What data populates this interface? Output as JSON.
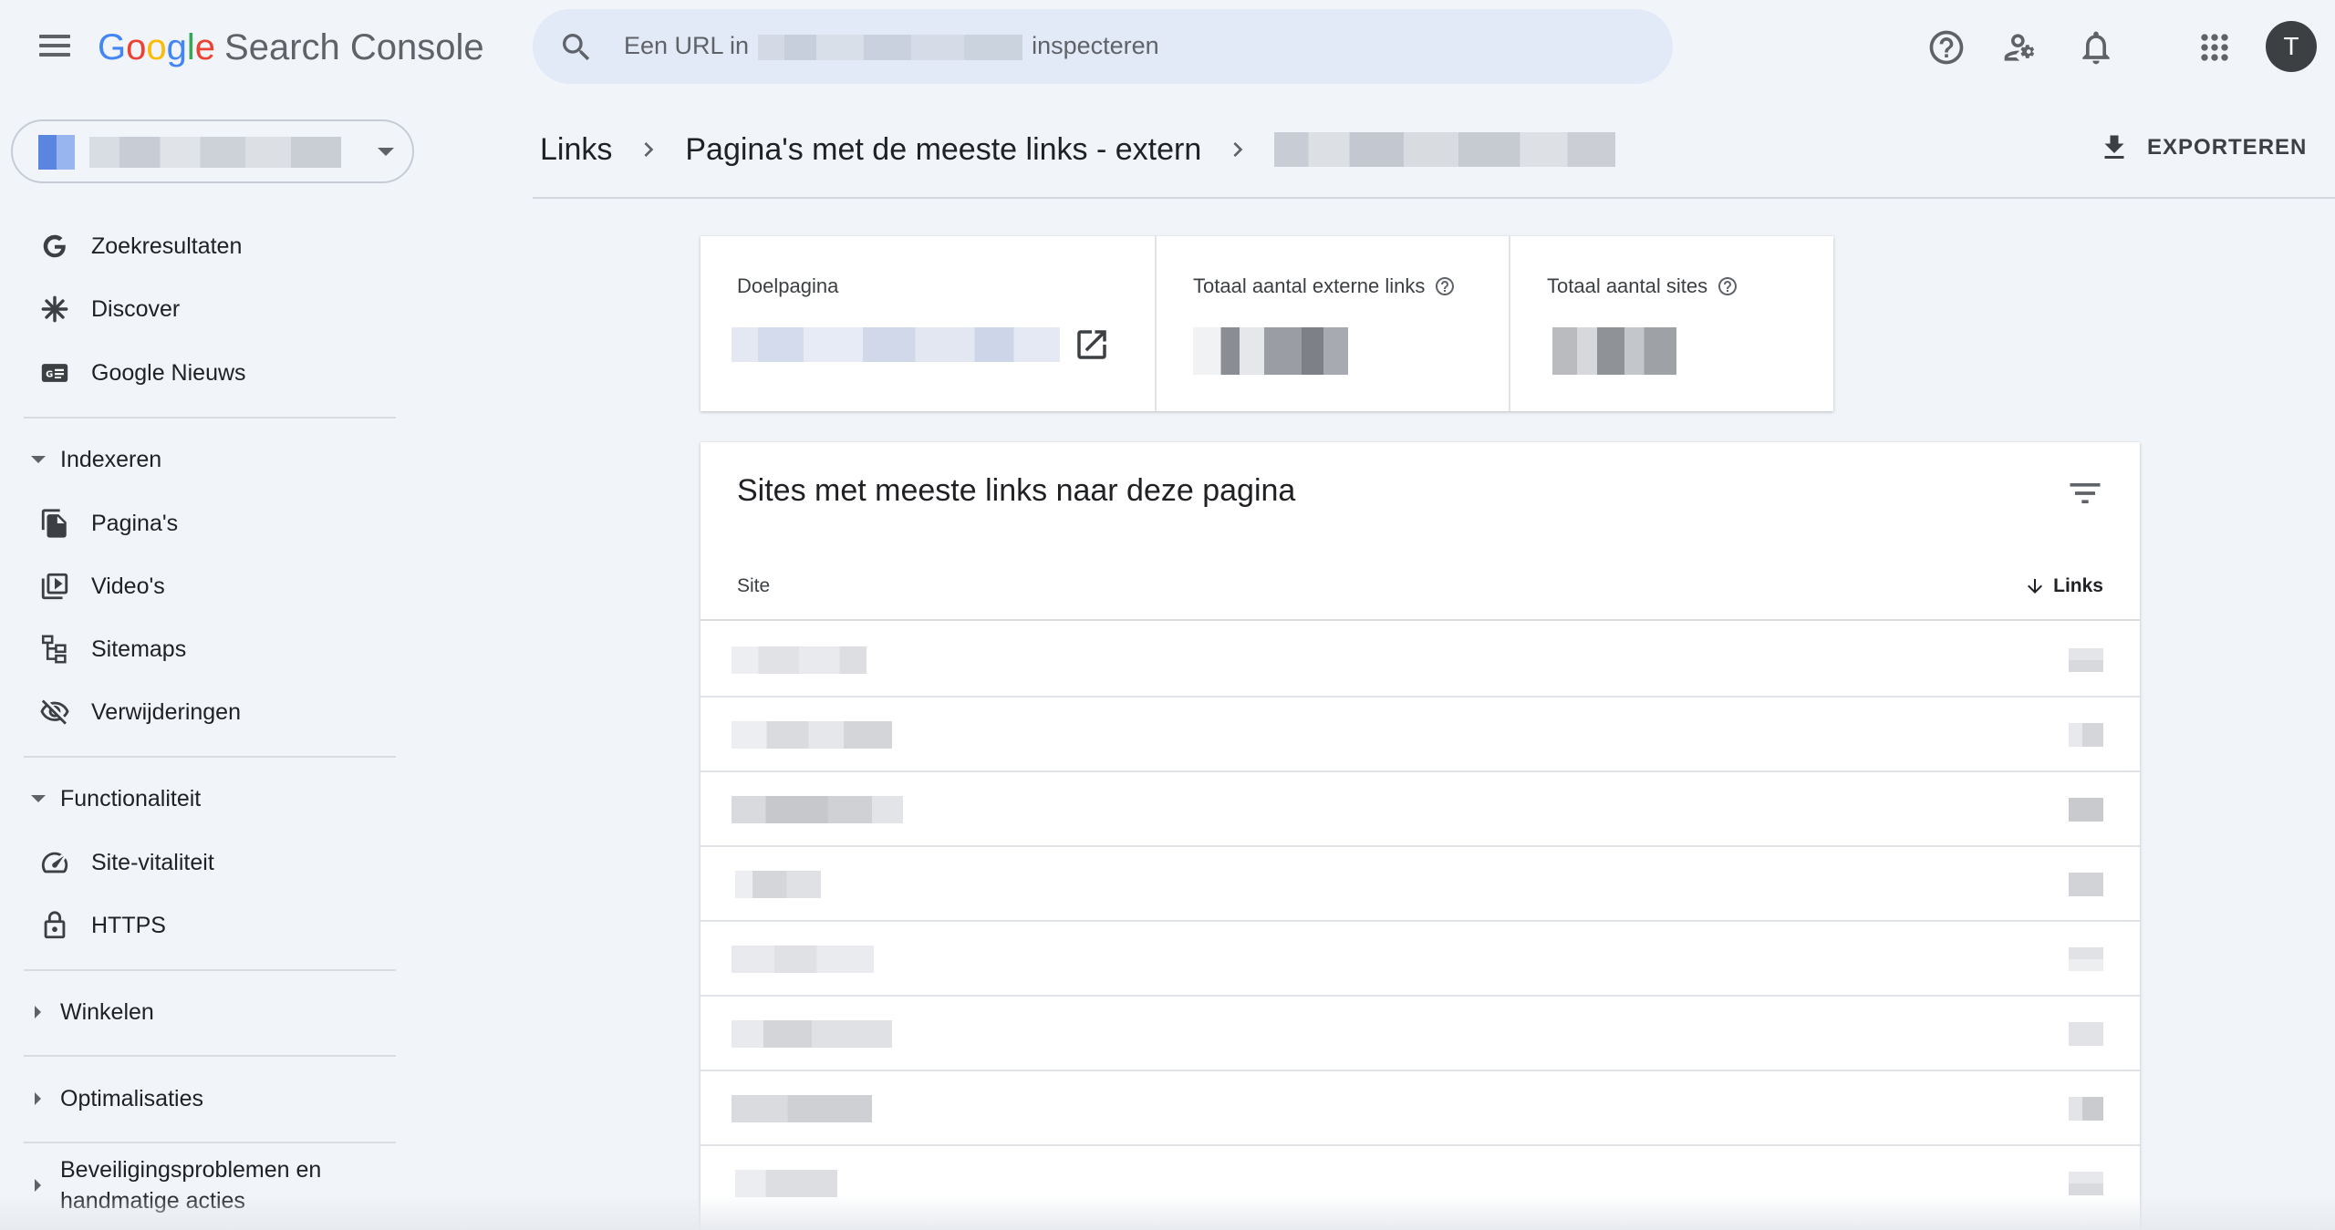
{
  "header": {
    "logo_letters": [
      "G",
      "o",
      "o",
      "g",
      "l",
      "e"
    ],
    "product": "Search Console",
    "search_prefix": "Een URL in",
    "search_suffix": "inspecteren",
    "avatar_initial": "T",
    "icons": [
      "menu-icon",
      "search-icon",
      "help-icon",
      "manage-users-icon",
      "notifications-icon",
      "apps-icon"
    ]
  },
  "sidebar": {
    "group1": [
      {
        "label": "Zoekresultaten",
        "icon": "google-g-icon"
      },
      {
        "label": "Discover",
        "icon": "asterisk-icon"
      },
      {
        "label": "Google Nieuws",
        "icon": "news-icon"
      }
    ],
    "sections": {
      "indexeren": "Indexeren",
      "functionaliteit": "Functionaliteit",
      "winkelen": "Winkelen",
      "optimalisaties": "Optimalisaties",
      "beveiliging": "Beveiligingsproblemen en handmatige acties"
    },
    "indexeren_items": [
      {
        "label": "Pagina's",
        "icon": "pages-icon"
      },
      {
        "label": "Video's",
        "icon": "video-icon"
      },
      {
        "label": "Sitemaps",
        "icon": "sitemap-icon"
      },
      {
        "label": "Verwijderingen",
        "icon": "visibility-off-icon"
      }
    ],
    "functionaliteit_items": [
      {
        "label": "Site-vitaliteit",
        "icon": "speed-icon"
      },
      {
        "label": "HTTPS",
        "icon": "lock-icon"
      }
    ]
  },
  "breadcrumb": {
    "level1": "Links",
    "level2": "Pagina's met de meeste links - extern"
  },
  "export_label": "EXPORTEREN",
  "summary": {
    "target_label": "Doelpagina",
    "total_links_label": "Totaal aantal externe links",
    "total_sites_label": "Totaal aantal sites"
  },
  "table": {
    "title": "Sites met meeste links naar deze pagina",
    "col_site": "Site",
    "col_links": "Links"
  }
}
